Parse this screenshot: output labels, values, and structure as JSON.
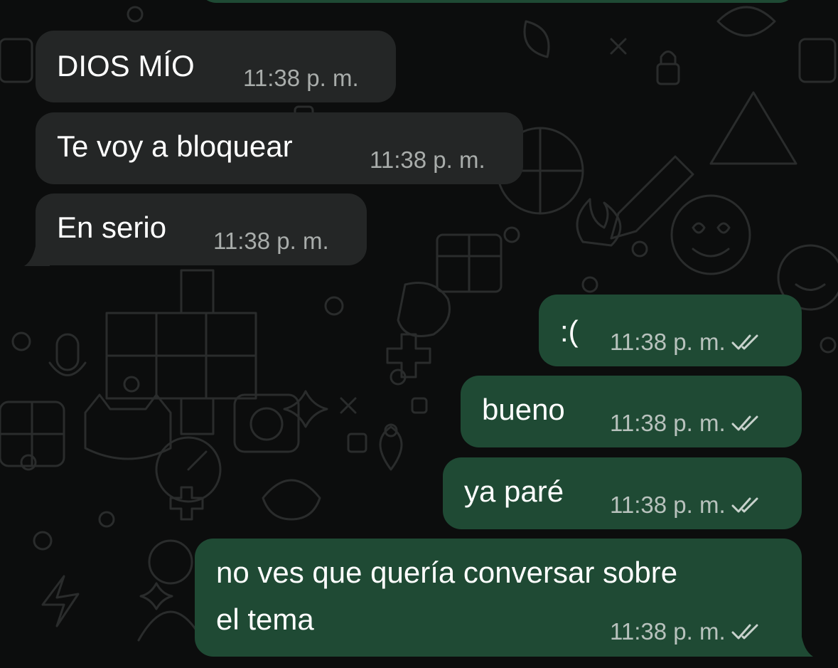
{
  "colors": {
    "background": "#0c0d0d",
    "incoming_bubble": "#242626",
    "outgoing_bubble": "#1f4a34",
    "text": "#ffffff",
    "timestamp": "#a9adab",
    "read_check": "#c8d2cc"
  },
  "messages": [
    {
      "direction": "incoming",
      "text": "DIOS MÍO",
      "time": "11:38 p. m."
    },
    {
      "direction": "incoming",
      "text": "Te voy a bloquear",
      "time": "11:38 p. m."
    },
    {
      "direction": "incoming",
      "text": "En serio",
      "time": "11:38 p. m."
    },
    {
      "direction": "outgoing",
      "text": ":(",
      "time": "11:38 p. m.",
      "status_icon": "double-check-icon"
    },
    {
      "direction": "outgoing",
      "text": "bueno",
      "time": "11:38 p. m.",
      "status_icon": "double-check-icon"
    },
    {
      "direction": "outgoing",
      "text": "ya paré",
      "time": "11:38 p. m.",
      "status_icon": "double-check-icon"
    },
    {
      "direction": "outgoing",
      "text": "no ves que quería conversar sobre",
      "text_line2": "el tema",
      "time": "11:38 p. m.",
      "status_icon": "double-check-icon"
    }
  ]
}
